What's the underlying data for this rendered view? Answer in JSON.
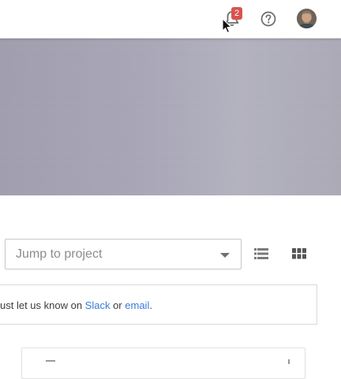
{
  "header": {
    "notifications": {
      "count": "2",
      "icon": "bell-icon",
      "badge_color": "#d9534f"
    },
    "help": {
      "icon": "help-circle-icon"
    },
    "avatar": {
      "icon": "user-avatar"
    }
  },
  "project_jump": {
    "placeholder": "Jump to project",
    "icon": "chevron-down-icon"
  },
  "view_toggle": {
    "list_icon": "list-view-icon",
    "grid_icon": "grid-view-icon"
  },
  "notice": {
    "prefix": "ust let us know on ",
    "slack_link": "Slack",
    "middle": " or ",
    "email_link": "email",
    "suffix": ".",
    "link_color": "#3a7bd5"
  }
}
